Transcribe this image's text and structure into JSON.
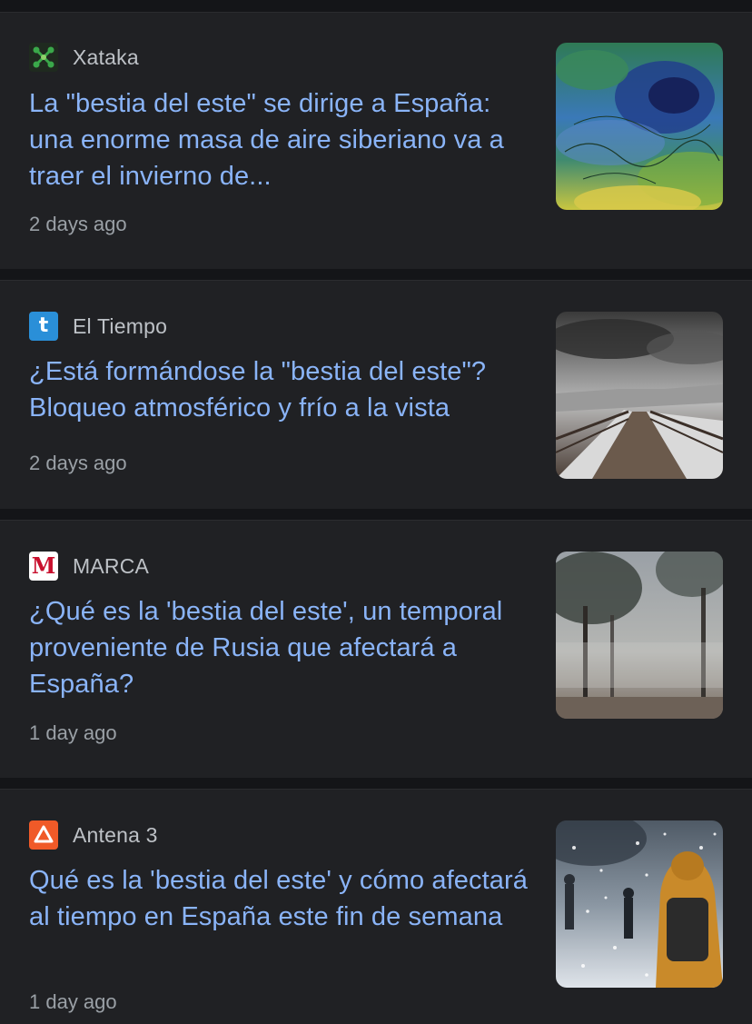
{
  "articles": [
    {
      "source": "Xataka",
      "logo_icon": "xataka-logo-icon",
      "headline": "La \"bestia del este\" se dirige a España: una enorme masa de aire siberiano va a traer el invierno de...",
      "time": "2 days ago",
      "thumbnail": "weather-map-thumbnail"
    },
    {
      "source": "El Tiempo",
      "logo_icon": "el-tiempo-logo-icon",
      "logo_letter": "t",
      "headline": "¿Está formándose la \"bestia del este\"? Bloqueo atmosférico y frío a la vista",
      "time": "2 days ago",
      "thumbnail": "snowy-bridge-thumbnail"
    },
    {
      "source": "MARCA",
      "logo_icon": "marca-logo-icon",
      "logo_letter": "M",
      "headline": "¿Qué es la 'bestia del este', un temporal proveniente de Rusia que afectará a España?",
      "time": "1 day ago",
      "thumbnail": "foggy-park-thumbnail"
    },
    {
      "source": "Antena 3",
      "logo_icon": "antena3-logo-icon",
      "headline": "Qué es la 'bestia del este' y cómo afectará al tiempo en España este fin de semana",
      "time": "1 day ago",
      "thumbnail": "snowfall-street-thumbnail"
    }
  ],
  "colors": {
    "background": "#141518",
    "card": "#202124",
    "headline": "#8ab4f8",
    "source": "#bdc1c6",
    "timestamp": "#9aa0a6",
    "xataka_green": "#3aa84a",
    "el_tiempo_blue": "#2a8fd8",
    "marca_red": "#c8102e",
    "antena3_orange": "#f05a28"
  }
}
